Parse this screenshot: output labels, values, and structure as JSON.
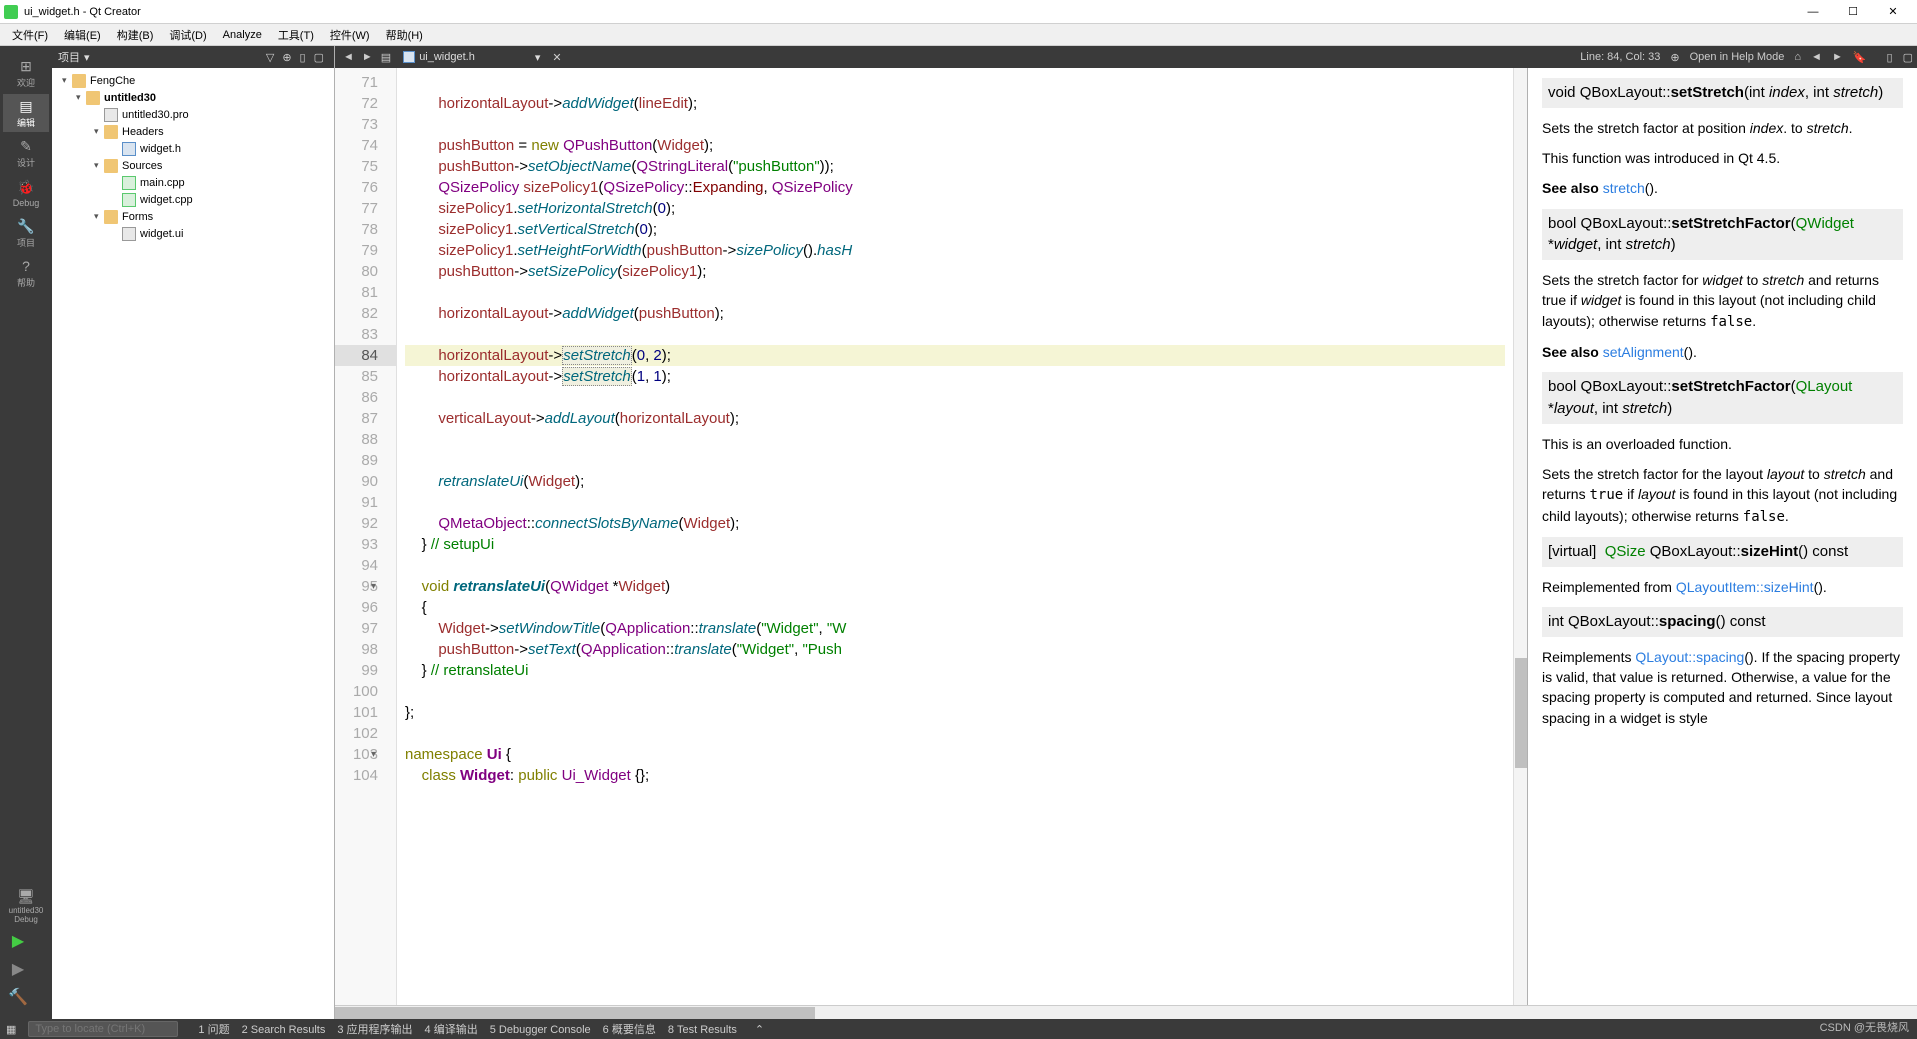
{
  "window": {
    "title": "ui_widget.h - Qt Creator"
  },
  "menus": [
    "文件(F)",
    "编辑(E)",
    "构建(B)",
    "调试(D)",
    "Analyze",
    "工具(T)",
    "控件(W)",
    "帮助(H)"
  ],
  "sidebar": {
    "items": [
      {
        "label": "欢迎",
        "icon": "⊞"
      },
      {
        "label": "编辑",
        "icon": "▤"
      },
      {
        "label": "设计",
        "icon": "✎"
      },
      {
        "label": "Debug",
        "icon": "🐞"
      },
      {
        "label": "项目",
        "icon": "🔧"
      },
      {
        "label": "帮助",
        "icon": "?"
      }
    ],
    "run_target": "untitled30",
    "run_mode": "Debug"
  },
  "project_panel": {
    "title": "项目",
    "tree": [
      {
        "depth": 0,
        "arrow": "▾",
        "icon": "folder",
        "label": "FengChe"
      },
      {
        "depth": 1,
        "arrow": "▾",
        "icon": "folder",
        "label": "untitled30",
        "bold": true
      },
      {
        "depth": 2,
        "arrow": "",
        "icon": "file",
        "label": "untitled30.pro"
      },
      {
        "depth": 2,
        "arrow": "▾",
        "icon": "folder",
        "label": "Headers"
      },
      {
        "depth": 3,
        "arrow": "",
        "icon": "h",
        "label": "widget.h"
      },
      {
        "depth": 2,
        "arrow": "▾",
        "icon": "folder",
        "label": "Sources"
      },
      {
        "depth": 3,
        "arrow": "",
        "icon": "cpp",
        "label": "main.cpp"
      },
      {
        "depth": 3,
        "arrow": "",
        "icon": "cpp",
        "label": "widget.cpp"
      },
      {
        "depth": 2,
        "arrow": "▾",
        "icon": "folder",
        "label": "Forms"
      },
      {
        "depth": 3,
        "arrow": "",
        "icon": "file",
        "label": "widget.ui"
      }
    ]
  },
  "editor": {
    "file_name": "ui_widget.h",
    "cursor_info": "Line: 84, Col: 33",
    "help_mode": "Open in Help Mode",
    "first_line": 71,
    "current_line": 84,
    "fold_lines": [
      95,
      103
    ],
    "lines": [
      {
        "n": 71,
        "tokens": []
      },
      {
        "n": 72,
        "tokens": [
          {
            "t": "        ",
            "c": ""
          },
          {
            "t": "horizontalLayout",
            "c": "var"
          },
          {
            "t": "->",
            "c": ""
          },
          {
            "t": "addWidget",
            "c": "fn"
          },
          {
            "t": "(",
            "c": ""
          },
          {
            "t": "lineEdit",
            "c": "var"
          },
          {
            "t": ");",
            "c": ""
          }
        ]
      },
      {
        "n": 73,
        "tokens": []
      },
      {
        "n": 74,
        "tokens": [
          {
            "t": "        ",
            "c": ""
          },
          {
            "t": "pushButton",
            "c": "var"
          },
          {
            "t": " = ",
            "c": ""
          },
          {
            "t": "new",
            "c": "kw"
          },
          {
            "t": " ",
            "c": ""
          },
          {
            "t": "QPushButton",
            "c": "type"
          },
          {
            "t": "(",
            "c": ""
          },
          {
            "t": "Widget",
            "c": "var"
          },
          {
            "t": ");",
            "c": ""
          }
        ]
      },
      {
        "n": 75,
        "tokens": [
          {
            "t": "        ",
            "c": ""
          },
          {
            "t": "pushButton",
            "c": "var"
          },
          {
            "t": "->",
            "c": ""
          },
          {
            "t": "setObjectName",
            "c": "fn"
          },
          {
            "t": "(",
            "c": ""
          },
          {
            "t": "QStringLiteral",
            "c": "type"
          },
          {
            "t": "(",
            "c": ""
          },
          {
            "t": "\"pushButton\"",
            "c": "str"
          },
          {
            "t": "));",
            "c": ""
          }
        ]
      },
      {
        "n": 76,
        "tokens": [
          {
            "t": "        ",
            "c": ""
          },
          {
            "t": "QSizePolicy",
            "c": "type"
          },
          {
            "t": " ",
            "c": ""
          },
          {
            "t": "sizePolicy1",
            "c": "var"
          },
          {
            "t": "(",
            "c": ""
          },
          {
            "t": "QSizePolicy",
            "c": "type"
          },
          {
            "t": "::",
            "c": ""
          },
          {
            "t": "Expanding",
            "c": "mem"
          },
          {
            "t": ", ",
            "c": ""
          },
          {
            "t": "QSizePolicy",
            "c": "type"
          }
        ]
      },
      {
        "n": 77,
        "tokens": [
          {
            "t": "        ",
            "c": ""
          },
          {
            "t": "sizePolicy1",
            "c": "var"
          },
          {
            "t": ".",
            "c": ""
          },
          {
            "t": "setHorizontalStretch",
            "c": "fn"
          },
          {
            "t": "(",
            "c": ""
          },
          {
            "t": "0",
            "c": "num"
          },
          {
            "t": ");",
            "c": ""
          }
        ]
      },
      {
        "n": 78,
        "tokens": [
          {
            "t": "        ",
            "c": ""
          },
          {
            "t": "sizePolicy1",
            "c": "var"
          },
          {
            "t": ".",
            "c": ""
          },
          {
            "t": "setVerticalStretch",
            "c": "fn"
          },
          {
            "t": "(",
            "c": ""
          },
          {
            "t": "0",
            "c": "num"
          },
          {
            "t": ");",
            "c": ""
          }
        ]
      },
      {
        "n": 79,
        "tokens": [
          {
            "t": "        ",
            "c": ""
          },
          {
            "t": "sizePolicy1",
            "c": "var"
          },
          {
            "t": ".",
            "c": ""
          },
          {
            "t": "setHeightForWidth",
            "c": "fn"
          },
          {
            "t": "(",
            "c": ""
          },
          {
            "t": "pushButton",
            "c": "var"
          },
          {
            "t": "->",
            "c": ""
          },
          {
            "t": "sizePolicy",
            "c": "fn"
          },
          {
            "t": "().",
            "c": ""
          },
          {
            "t": "hasH",
            "c": "fn"
          }
        ]
      },
      {
        "n": 80,
        "tokens": [
          {
            "t": "        ",
            "c": ""
          },
          {
            "t": "pushButton",
            "c": "var"
          },
          {
            "t": "->",
            "c": ""
          },
          {
            "t": "setSizePolicy",
            "c": "fn"
          },
          {
            "t": "(",
            "c": ""
          },
          {
            "t": "sizePolicy1",
            "c": "var"
          },
          {
            "t": ");",
            "c": ""
          }
        ]
      },
      {
        "n": 81,
        "tokens": []
      },
      {
        "n": 82,
        "tokens": [
          {
            "t": "        ",
            "c": ""
          },
          {
            "t": "horizontalLayout",
            "c": "var"
          },
          {
            "t": "->",
            "c": ""
          },
          {
            "t": "addWidget",
            "c": "fn"
          },
          {
            "t": "(",
            "c": ""
          },
          {
            "t": "pushButton",
            "c": "var"
          },
          {
            "t": ");",
            "c": ""
          }
        ]
      },
      {
        "n": 83,
        "tokens": []
      },
      {
        "n": 84,
        "tokens": [
          {
            "t": "        ",
            "c": ""
          },
          {
            "t": "horizontalLayout",
            "c": "var"
          },
          {
            "t": "->",
            "c": ""
          },
          {
            "t": "setStretch",
            "c": "fn",
            "sel": true
          },
          {
            "t": "(",
            "c": ""
          },
          {
            "t": "0",
            "c": "num"
          },
          {
            "t": ", ",
            "c": ""
          },
          {
            "t": "2",
            "c": "num"
          },
          {
            "t": ");",
            "c": ""
          }
        ]
      },
      {
        "n": 85,
        "tokens": [
          {
            "t": "        ",
            "c": ""
          },
          {
            "t": "horizontalLayout",
            "c": "var"
          },
          {
            "t": "->",
            "c": ""
          },
          {
            "t": "setStretch",
            "c": "fn",
            "sel": true
          },
          {
            "t": "(",
            "c": ""
          },
          {
            "t": "1",
            "c": "num"
          },
          {
            "t": ", ",
            "c": ""
          },
          {
            "t": "1",
            "c": "num"
          },
          {
            "t": ");",
            "c": ""
          }
        ]
      },
      {
        "n": 86,
        "tokens": []
      },
      {
        "n": 87,
        "tokens": [
          {
            "t": "        ",
            "c": ""
          },
          {
            "t": "verticalLayout",
            "c": "var"
          },
          {
            "t": "->",
            "c": ""
          },
          {
            "t": "addLayout",
            "c": "fn"
          },
          {
            "t": "(",
            "c": ""
          },
          {
            "t": "horizontalLayout",
            "c": "var"
          },
          {
            "t": ");",
            "c": ""
          }
        ]
      },
      {
        "n": 88,
        "tokens": []
      },
      {
        "n": 89,
        "tokens": []
      },
      {
        "n": 90,
        "tokens": [
          {
            "t": "        ",
            "c": ""
          },
          {
            "t": "retranslateUi",
            "c": "fn"
          },
          {
            "t": "(",
            "c": ""
          },
          {
            "t": "Widget",
            "c": "var"
          },
          {
            "t": ");",
            "c": ""
          }
        ]
      },
      {
        "n": 91,
        "tokens": []
      },
      {
        "n": 92,
        "tokens": [
          {
            "t": "        ",
            "c": ""
          },
          {
            "t": "QMetaObject",
            "c": "type"
          },
          {
            "t": "::",
            "c": ""
          },
          {
            "t": "connectSlotsByName",
            "c": "fn"
          },
          {
            "t": "(",
            "c": ""
          },
          {
            "t": "Widget",
            "c": "var"
          },
          {
            "t": ");",
            "c": ""
          }
        ]
      },
      {
        "n": 93,
        "tokens": [
          {
            "t": "    } ",
            "c": ""
          },
          {
            "t": "// setupUi",
            "c": "cmt"
          }
        ]
      },
      {
        "n": 94,
        "tokens": []
      },
      {
        "n": 95,
        "tokens": [
          {
            "t": "    ",
            "c": ""
          },
          {
            "t": "void",
            "c": "kw"
          },
          {
            "t": " ",
            "c": ""
          },
          {
            "t": "retranslateUi",
            "c": "fn",
            "bold": true
          },
          {
            "t": "(",
            "c": ""
          },
          {
            "t": "QWidget",
            "c": "type"
          },
          {
            "t": " *",
            "c": ""
          },
          {
            "t": "Widget",
            "c": "var"
          },
          {
            "t": ")",
            "c": ""
          }
        ]
      },
      {
        "n": 96,
        "tokens": [
          {
            "t": "    {",
            "c": ""
          }
        ]
      },
      {
        "n": 97,
        "tokens": [
          {
            "t": "        ",
            "c": ""
          },
          {
            "t": "Widget",
            "c": "var"
          },
          {
            "t": "->",
            "c": ""
          },
          {
            "t": "setWindowTitle",
            "c": "fn"
          },
          {
            "t": "(",
            "c": ""
          },
          {
            "t": "QApplication",
            "c": "type"
          },
          {
            "t": "::",
            "c": ""
          },
          {
            "t": "translate",
            "c": "fn"
          },
          {
            "t": "(",
            "c": ""
          },
          {
            "t": "\"Widget\"",
            "c": "str"
          },
          {
            "t": ", ",
            "c": ""
          },
          {
            "t": "\"W",
            "c": "str"
          }
        ]
      },
      {
        "n": 98,
        "tokens": [
          {
            "t": "        ",
            "c": ""
          },
          {
            "t": "pushButton",
            "c": "var"
          },
          {
            "t": "->",
            "c": ""
          },
          {
            "t": "setText",
            "c": "fn"
          },
          {
            "t": "(",
            "c": ""
          },
          {
            "t": "QApplication",
            "c": "type"
          },
          {
            "t": "::",
            "c": ""
          },
          {
            "t": "translate",
            "c": "fn"
          },
          {
            "t": "(",
            "c": ""
          },
          {
            "t": "\"Widget\"",
            "c": "str"
          },
          {
            "t": ", ",
            "c": ""
          },
          {
            "t": "\"Push",
            "c": "str"
          }
        ]
      },
      {
        "n": 99,
        "tokens": [
          {
            "t": "    } ",
            "c": ""
          },
          {
            "t": "// retranslateUi",
            "c": "cmt"
          }
        ]
      },
      {
        "n": 100,
        "tokens": []
      },
      {
        "n": 101,
        "tokens": [
          {
            "t": "};",
            "c": ""
          }
        ]
      },
      {
        "n": 102,
        "tokens": []
      },
      {
        "n": 103,
        "tokens": [
          {
            "t": "namespace",
            "c": "kw"
          },
          {
            "t": " ",
            "c": ""
          },
          {
            "t": "Ui",
            "c": "type",
            "bold": true
          },
          {
            "t": " {",
            "c": ""
          }
        ]
      },
      {
        "n": 104,
        "tokens": [
          {
            "t": "    ",
            "c": ""
          },
          {
            "t": "class",
            "c": "kw"
          },
          {
            "t": " ",
            "c": ""
          },
          {
            "t": "Widget",
            "c": "type",
            "bold": true
          },
          {
            "t": ": ",
            "c": ""
          },
          {
            "t": "public",
            "c": "kw"
          },
          {
            "t": " ",
            "c": ""
          },
          {
            "t": "Ui_Widget",
            "c": "type"
          },
          {
            "t": " {};",
            "c": ""
          }
        ]
      }
    ]
  },
  "help": {
    "sections": [
      {
        "type": "sig",
        "html": "<span class='rt'>void</span> QBoxLayout::<span class='mth'>setStretch</span>(<span class='rt'>int</span> <span class='prm'>index</span>, <span class='rt'>int</span> <span class='prm'>stretch</span>)"
      },
      {
        "type": "p",
        "html": "Sets the stretch factor at position <span class='em'>index</span>. to <span class='em'>stretch</span>."
      },
      {
        "type": "p",
        "html": "This function was introduced in Qt 4.5."
      },
      {
        "type": "p",
        "html": "<span class='bold'>See also</span> <span class='link'>stretch</span>()."
      },
      {
        "type": "sig",
        "html": "<span class='rt'>bool</span> QBoxLayout::<span class='mth'>setStretchFactor</span>(<span class='ptype'>QWidget</span> *<span class='prm'>widget</span>, <span class='rt'>int</span> <span class='prm'>stretch</span>)"
      },
      {
        "type": "p",
        "html": "Sets the stretch factor for <span class='em'>widget</span> to <span class='em'>stretch</span> and returns true if <span class='em'>widget</span> is found in this layout (not including child layouts); otherwise returns <span class='code-inline'>false</span>."
      },
      {
        "type": "p",
        "html": "<span class='bold'>See also</span> <span class='link'>setAlignment</span>()."
      },
      {
        "type": "sig",
        "html": "<span class='rt'>bool</span> QBoxLayout::<span class='mth'>setStretchFactor</span>(<span class='ptype'>QLayout</span> *<span class='prm'>layout</span>, <span class='rt'>int</span> <span class='prm'>stretch</span>)"
      },
      {
        "type": "p",
        "html": "This is an overloaded function."
      },
      {
        "type": "p",
        "html": "Sets the stretch factor for the layout <span class='em'>layout</span> to <span class='em'>stretch</span> and returns <span class='code-inline'>true</span> if <span class='em'>layout</span> is found in this layout (not including child layouts); otherwise returns <span class='code-inline'>false</span>."
      },
      {
        "type": "sig",
        "html": "<span class='code-inline'>[virtual]</span>&nbsp; <span class='ptype'>QSize</span> QBoxLayout::<span class='mth'>sizeHint</span>() const"
      },
      {
        "type": "p",
        "html": "Reimplemented from <span class='link'>QLayoutItem::sizeHint</span>()."
      },
      {
        "type": "sig",
        "html": "<span class='rt'>int</span> QBoxLayout::<span class='mth'>spacing</span>() const"
      },
      {
        "type": "p",
        "html": "Reimplements <span class='link'>QLayout::spacing</span>(). If the spacing property is valid, that value is returned. Otherwise, a value for the spacing property is computed and returned. Since layout spacing in a widget is style"
      }
    ]
  },
  "status": {
    "search_placeholder": "Type to locate (Ctrl+K)",
    "items": [
      "1  问题",
      "2  Search Results",
      "3  应用程序输出",
      "4  编译输出",
      "5  Debugger Console",
      "6  概要信息",
      "8  Test Results"
    ]
  },
  "watermark": "CSDN @无畏烧风"
}
